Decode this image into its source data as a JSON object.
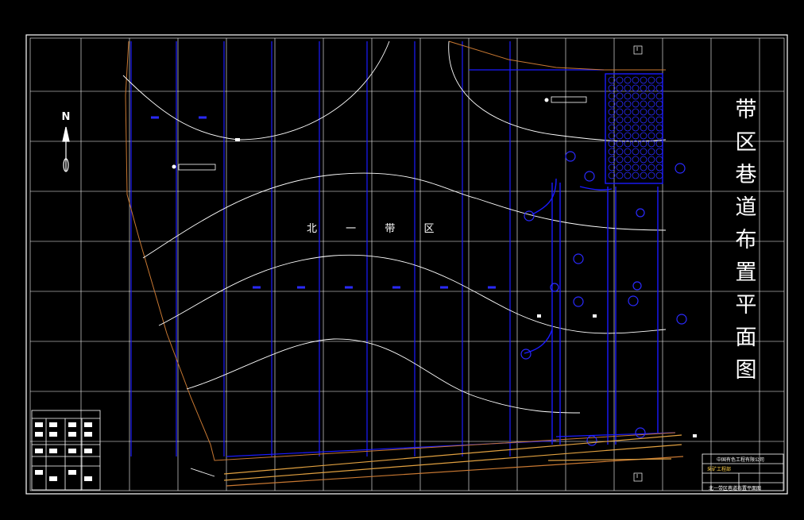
{
  "drawing": {
    "vertical_title": [
      "带",
      "区",
      "巷",
      "道",
      "布",
      "置",
      "平",
      "面",
      "图"
    ],
    "region_label": [
      "北",
      "一",
      "带",
      "区"
    ],
    "north_label": "N",
    "side_marks": [
      "I",
      "I"
    ],
    "colors": {
      "background": "#000000",
      "grid": "#ffffff",
      "roadway": "#1a1aff",
      "contour": "#ffffff",
      "boundary": "#c87832",
      "transport": "#e0a040"
    }
  },
  "title_block": {
    "line1": "中国有色工程有限公司",
    "line2": "采矿工程部",
    "line3": "北一带区巷道布置平面图"
  }
}
